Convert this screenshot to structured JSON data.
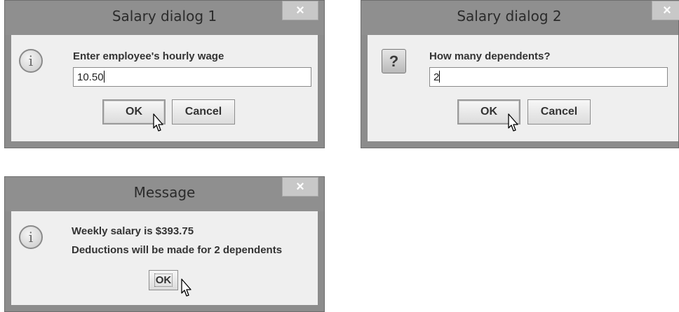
{
  "dialog1": {
    "title": "Salary dialog 1",
    "close_glyph": "×",
    "icon": "information-icon",
    "prompt": "Enter employee's hourly wage",
    "input_value": "10.50",
    "ok_label": "OK",
    "cancel_label": "Cancel"
  },
  "dialog2": {
    "title": "Salary dialog 2",
    "close_glyph": "×",
    "icon": "question-icon",
    "icon_glyph": "?",
    "prompt": "How many dependents?",
    "input_value": "2",
    "ok_label": "OK",
    "cancel_label": "Cancel"
  },
  "message": {
    "title": "Message",
    "close_glyph": "×",
    "icon": "information-icon",
    "line1": "Weekly salary is $393.75",
    "line2": "Deductions will be made for 2 dependents",
    "ok_label": "OK"
  },
  "info_glyph": "i"
}
